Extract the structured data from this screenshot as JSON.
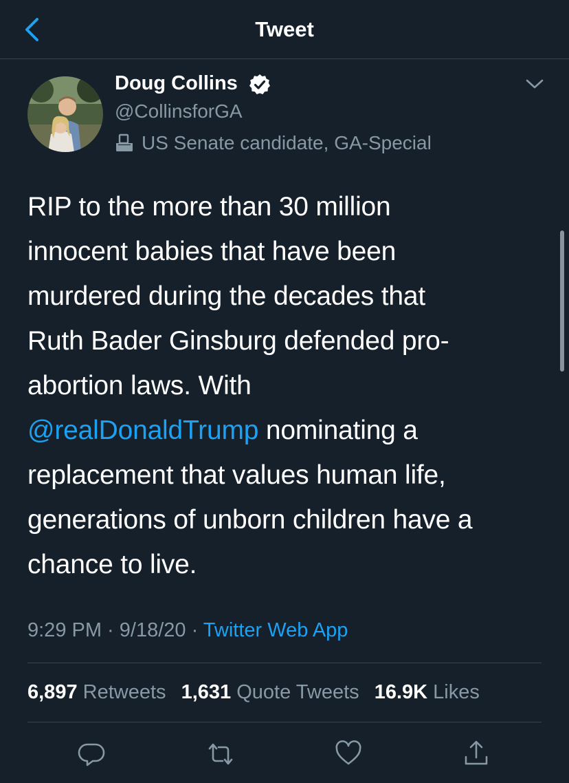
{
  "header": {
    "title": "Tweet"
  },
  "tweet": {
    "author": {
      "name": "Doug Collins",
      "handle": "@CollinsforGA",
      "label": "US Senate candidate, GA-Special"
    },
    "text_lines": {
      "l1": "RIP to the more than 30 million",
      "l2": "innocent babies that have been",
      "l3": "murdered during the decades that",
      "l4": "Ruth Bader Ginsburg defended pro-",
      "l5": "abortion laws. With",
      "l6_mention": "@realDonaldTrump",
      "l6_rest": " nominating a",
      "l7": "replacement that values human life,",
      "l8": "generations of unborn children have a",
      "l9": "chance to live."
    },
    "meta": {
      "time": "9:29 PM",
      "sep1": " · ",
      "date": "9/18/20",
      "sep2": " · ",
      "source": "Twitter Web App"
    },
    "stats": {
      "retweets_count": "6,897",
      "retweets_label": "Retweets",
      "quotes_count": "1,631",
      "quotes_label": "Quote Tweets",
      "likes_count": "16.9K",
      "likes_label": "Likes"
    }
  },
  "colors": {
    "background": "#15202b",
    "accent": "#1da1f2",
    "secondary_text": "#8899a6",
    "divider": "#38444d"
  },
  "icons": {
    "back": "chevron-left-icon",
    "verified": "verified-badge-icon",
    "label": "ballot-box-icon",
    "more": "chevron-down-icon",
    "reply": "reply-icon",
    "retweet": "retweet-icon",
    "like": "heart-icon",
    "share": "share-icon"
  }
}
